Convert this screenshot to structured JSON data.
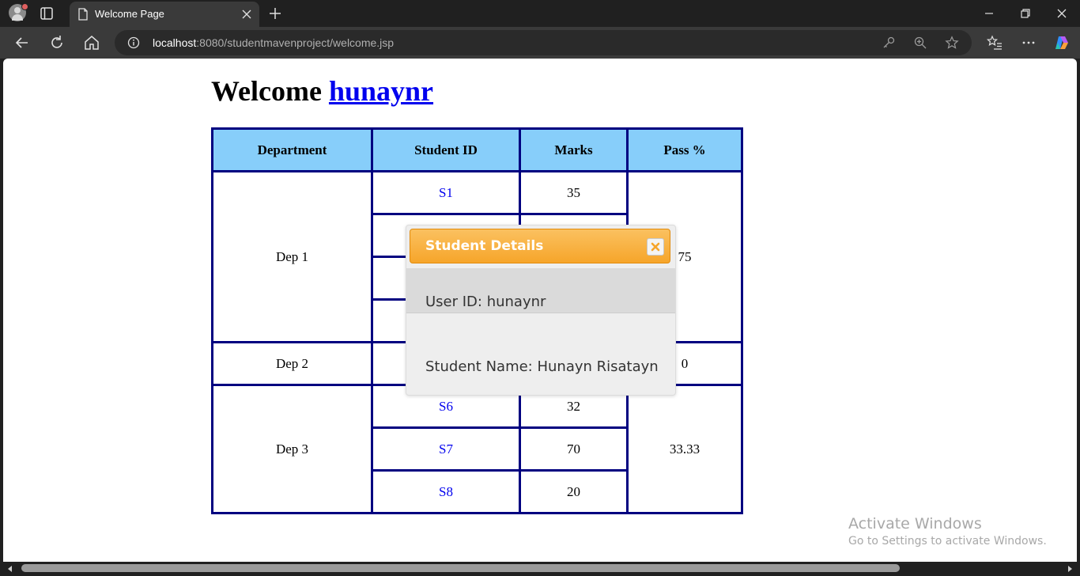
{
  "browser": {
    "tab_title": "Welcome Page",
    "url_host": "localhost",
    "url_rest": ":8080/studentmavenproject/welcome.jsp"
  },
  "page": {
    "welcome_prefix": "Welcome",
    "username": "hunaynr"
  },
  "table": {
    "headers": [
      "Department",
      "Student ID",
      "Marks",
      "Pass %"
    ],
    "departments": [
      {
        "name": "Dep 1",
        "pass": "75",
        "rows": [
          {
            "id": "S1",
            "marks": "35"
          },
          {
            "id": "",
            "marks": ""
          },
          {
            "id": "",
            "marks": ""
          },
          {
            "id": "",
            "marks": ""
          }
        ]
      },
      {
        "name": "Dep 2",
        "pass": "0",
        "rows": [
          {
            "id": "",
            "marks": ""
          }
        ]
      },
      {
        "name": "Dep 3",
        "pass": "33.33",
        "rows": [
          {
            "id": "S6",
            "marks": "32"
          },
          {
            "id": "S7",
            "marks": "70"
          },
          {
            "id": "S8",
            "marks": "20"
          }
        ]
      }
    ]
  },
  "dialog": {
    "title": "Student Details",
    "user_id_line": "User ID: hunaynr",
    "student_name_line": "Student Name: Hunayn Risatayn"
  },
  "watermark": {
    "line1": "Activate Windows",
    "line2": "Go to Settings to activate Windows."
  },
  "colors": {
    "header_bg": "#87cefa",
    "border": "#000080",
    "dialog_header": "#f6a52a",
    "link": "#0000ee"
  }
}
